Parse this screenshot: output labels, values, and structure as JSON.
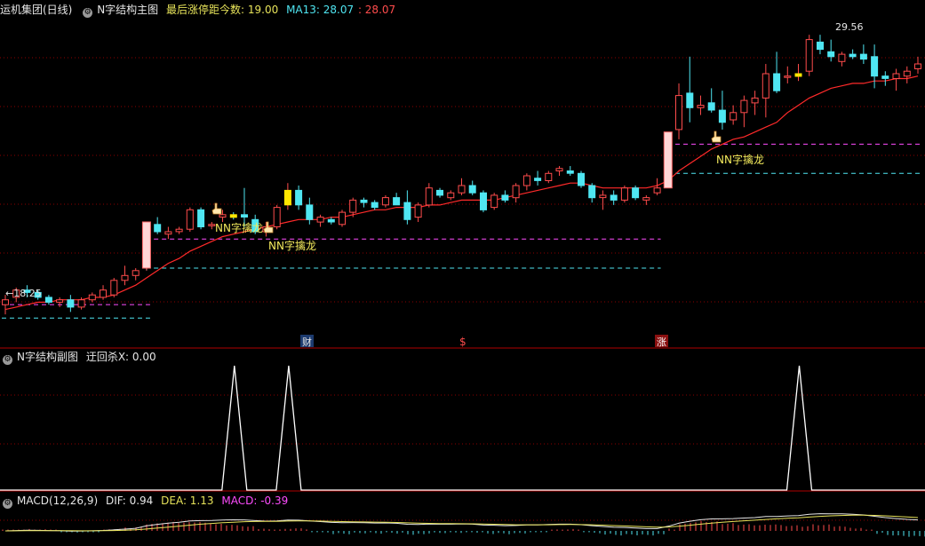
{
  "main_header": {
    "title": "运机集团(日线)",
    "indicator": "N字结构主图",
    "last_label": "最后涨停距今数: 19.00",
    "ma_label": "MA13: 28.07",
    "price_value": ": 28.07"
  },
  "sub_header": {
    "indicator": "N字结构副图",
    "value_label": "迂回杀X: 0.00"
  },
  "macd_header": {
    "name": "MACD(12,26,9)",
    "dif": "DIF: 0.94",
    "dea": "DEA: 1.13",
    "macd": "MACD: -0.39"
  },
  "annotations": {
    "low_price": "←18.25",
    "high_price": "29.56",
    "signal_1": "NN字擒龙",
    "signal_2": "NN字擒龙",
    "signal_3": "NN字擒龙",
    "event_cai": "财",
    "event_s": "$",
    "event_zhang": "涨"
  },
  "colors": {
    "up": "#ff4c4c",
    "down": "#4fe6f2",
    "ma": "#ff2a2a",
    "dash_magenta": "#ff4cff",
    "dash_cyan": "#4fe6f2",
    "grid": "#8b0000",
    "limit_bar": "#ffd7d7",
    "signal_bar": "#ffe600"
  },
  "icons": {
    "gear": "gear-icon",
    "hand": "hand-pointer-icon"
  },
  "chart_data": [
    {
      "type": "candlestick",
      "title": "运机集团(日线)",
      "ylim": [
        17.5,
        30.5
      ],
      "ohlc": [
        [
          18.7,
          19.1,
          18.3,
          18.9
        ],
        [
          19.0,
          19.4,
          18.8,
          19.3
        ],
        [
          19.3,
          19.5,
          19.0,
          19.2
        ],
        [
          19.2,
          19.3,
          18.9,
          19.0
        ],
        [
          19.0,
          19.1,
          18.7,
          18.8
        ],
        [
          18.8,
          19.0,
          18.6,
          18.9
        ],
        [
          18.9,
          19.1,
          18.4,
          18.6
        ],
        [
          18.6,
          19.0,
          18.5,
          18.9
        ],
        [
          18.9,
          19.2,
          18.8,
          19.1
        ],
        [
          19.0,
          19.5,
          18.9,
          19.3
        ],
        [
          19.1,
          19.8,
          19.0,
          19.7
        ],
        [
          19.7,
          20.3,
          19.5,
          19.9
        ],
        [
          19.9,
          20.2,
          19.7,
          20.1
        ],
        [
          20.2,
          22.1,
          20.1,
          22.1
        ],
        [
          22.0,
          22.3,
          21.6,
          21.7
        ],
        [
          21.6,
          21.9,
          21.4,
          21.7
        ],
        [
          21.7,
          21.9,
          21.6,
          21.8
        ],
        [
          21.8,
          22.7,
          21.7,
          22.6
        ],
        [
          22.6,
          22.7,
          21.8,
          21.9
        ],
        [
          22.0,
          22.1,
          21.8,
          22.0
        ],
        [
          22.3,
          22.6,
          22.1,
          22.4
        ],
        [
          22.4,
          22.5,
          22.2,
          22.3
        ],
        [
          22.4,
          23.5,
          21.9,
          22.3
        ],
        [
          22.2,
          22.4,
          21.6,
          21.7
        ],
        [
          21.7,
          22.1,
          21.5,
          21.9
        ],
        [
          21.9,
          22.8,
          21.8,
          22.7
        ],
        [
          22.8,
          23.7,
          22.6,
          23.4
        ],
        [
          23.4,
          23.6,
          22.6,
          22.8
        ],
        [
          22.8,
          23.1,
          22.0,
          22.2
        ],
        [
          22.1,
          22.4,
          21.9,
          22.3
        ],
        [
          22.2,
          22.3,
          22.0,
          22.1
        ],
        [
          22.0,
          22.6,
          21.9,
          22.5
        ],
        [
          22.5,
          23.1,
          22.3,
          23.0
        ],
        [
          23.0,
          23.1,
          22.7,
          22.9
        ],
        [
          22.9,
          23.0,
          22.6,
          22.7
        ],
        [
          22.8,
          23.2,
          22.7,
          23.1
        ],
        [
          23.1,
          23.3,
          22.8,
          22.8
        ],
        [
          22.9,
          23.4,
          22.0,
          22.2
        ],
        [
          22.3,
          22.9,
          22.1,
          22.8
        ],
        [
          22.8,
          23.7,
          22.7,
          23.5
        ],
        [
          23.4,
          23.5,
          23.1,
          23.2
        ],
        [
          23.1,
          23.4,
          23.0,
          23.3
        ],
        [
          23.3,
          23.9,
          23.2,
          23.6
        ],
        [
          23.6,
          23.8,
          23.2,
          23.3
        ],
        [
          23.3,
          23.4,
          22.5,
          22.6
        ],
        [
          22.7,
          23.3,
          22.6,
          23.2
        ],
        [
          23.2,
          23.4,
          22.9,
          23.0
        ],
        [
          23.1,
          23.7,
          22.9,
          23.6
        ],
        [
          23.6,
          24.1,
          23.4,
          24.0
        ],
        [
          23.9,
          24.2,
          23.6,
          23.8
        ],
        [
          23.8,
          24.2,
          23.7,
          24.1
        ],
        [
          24.2,
          24.4,
          24.0,
          24.3
        ],
        [
          24.2,
          24.4,
          24.0,
          24.1
        ],
        [
          24.1,
          24.2,
          23.5,
          23.6
        ],
        [
          23.6,
          23.7,
          22.9,
          23.1
        ],
        [
          23.1,
          23.4,
          22.6,
          23.2
        ],
        [
          23.2,
          23.4,
          22.8,
          23.0
        ],
        [
          23.0,
          23.6,
          22.9,
          23.5
        ],
        [
          23.5,
          23.6,
          23.0,
          23.1
        ],
        [
          23.0,
          23.2,
          22.8,
          23.1
        ],
        [
          23.3,
          23.9,
          23.2,
          23.5
        ],
        [
          23.5,
          25.8,
          23.5,
          25.8
        ],
        [
          25.9,
          27.8,
          25.5,
          27.3
        ],
        [
          27.4,
          28.9,
          26.2,
          26.8
        ],
        [
          26.8,
          27.3,
          26.5,
          26.9
        ],
        [
          27.0,
          27.6,
          26.6,
          26.7
        ],
        [
          26.7,
          27.5,
          25.9,
          26.2
        ],
        [
          26.3,
          26.9,
          26.1,
          26.6
        ],
        [
          26.6,
          27.3,
          26.0,
          27.1
        ],
        [
          27.0,
          27.5,
          26.5,
          27.2
        ],
        [
          27.2,
          28.6,
          26.4,
          28.2
        ],
        [
          28.2,
          29.1,
          27.4,
          27.5
        ],
        [
          28.1,
          28.5,
          27.8,
          28.1
        ],
        [
          28.1,
          28.6,
          27.9,
          28.2
        ],
        [
          28.3,
          29.8,
          28.1,
          29.6
        ],
        [
          29.5,
          29.8,
          29.0,
          29.2
        ],
        [
          29.1,
          29.6,
          28.7,
          28.9
        ],
        [
          28.7,
          29.1,
          28.5,
          29.0
        ],
        [
          29.0,
          29.2,
          28.8,
          28.9
        ],
        [
          29.0,
          29.4,
          28.6,
          28.8
        ],
        [
          28.9,
          29.4,
          27.6,
          28.1
        ],
        [
          28.1,
          28.3,
          27.7,
          28.0
        ],
        [
          28.0,
          28.4,
          27.5,
          28.2
        ],
        [
          28.1,
          28.5,
          27.8,
          28.3
        ],
        [
          28.4,
          28.9,
          28.2,
          28.6
        ]
      ],
      "ma13": [
        18.5,
        18.6,
        18.7,
        18.8,
        18.8,
        18.9,
        18.9,
        18.9,
        19.0,
        19.0,
        19.1,
        19.3,
        19.5,
        19.8,
        20.1,
        20.4,
        20.6,
        20.9,
        21.1,
        21.3,
        21.5,
        21.6,
        21.7,
        21.8,
        21.9,
        22.0,
        22.1,
        22.2,
        22.2,
        22.2,
        22.3,
        22.3,
        22.4,
        22.5,
        22.6,
        22.6,
        22.7,
        22.7,
        22.7,
        22.8,
        22.8,
        22.9,
        23.0,
        23.0,
        23.0,
        23.0,
        23.1,
        23.2,
        23.3,
        23.4,
        23.5,
        23.6,
        23.7,
        23.7,
        23.6,
        23.5,
        23.5,
        23.5,
        23.5,
        23.5,
        23.6,
        23.8,
        24.2,
        24.5,
        24.8,
        25.1,
        25.3,
        25.5,
        25.6,
        25.8,
        26.0,
        26.2,
        26.6,
        26.9,
        27.2,
        27.4,
        27.6,
        27.7,
        27.8,
        27.8,
        27.9,
        27.9,
        28.0,
        28.0,
        28.1
      ],
      "limit_up_index": [
        13,
        61
      ],
      "signal_index": [
        21,
        26,
        73
      ],
      "support_levels": [
        {
          "magenta": 18.7,
          "cyan": 18.15,
          "from": 0,
          "to": 13
        },
        {
          "magenta": 21.4,
          "cyan": 20.2,
          "from": 14,
          "to": 60
        },
        {
          "magenta": 25.3,
          "cyan": 24.1,
          "from": 62,
          "to": 84
        }
      ]
    },
    {
      "type": "line",
      "title": "N字结构副图",
      "ylim": [
        0,
        1
      ],
      "series": [
        {
          "name": "迂回杀X",
          "peaks": [
            21,
            26,
            73
          ]
        }
      ]
    },
    {
      "type": "bar",
      "title": "MACD(12,26,9)",
      "series": [
        {
          "name": "DIF",
          "value": 0.94
        },
        {
          "name": "DEA",
          "value": 1.13
        },
        {
          "name": "MACD",
          "value": -0.39
        }
      ]
    }
  ]
}
